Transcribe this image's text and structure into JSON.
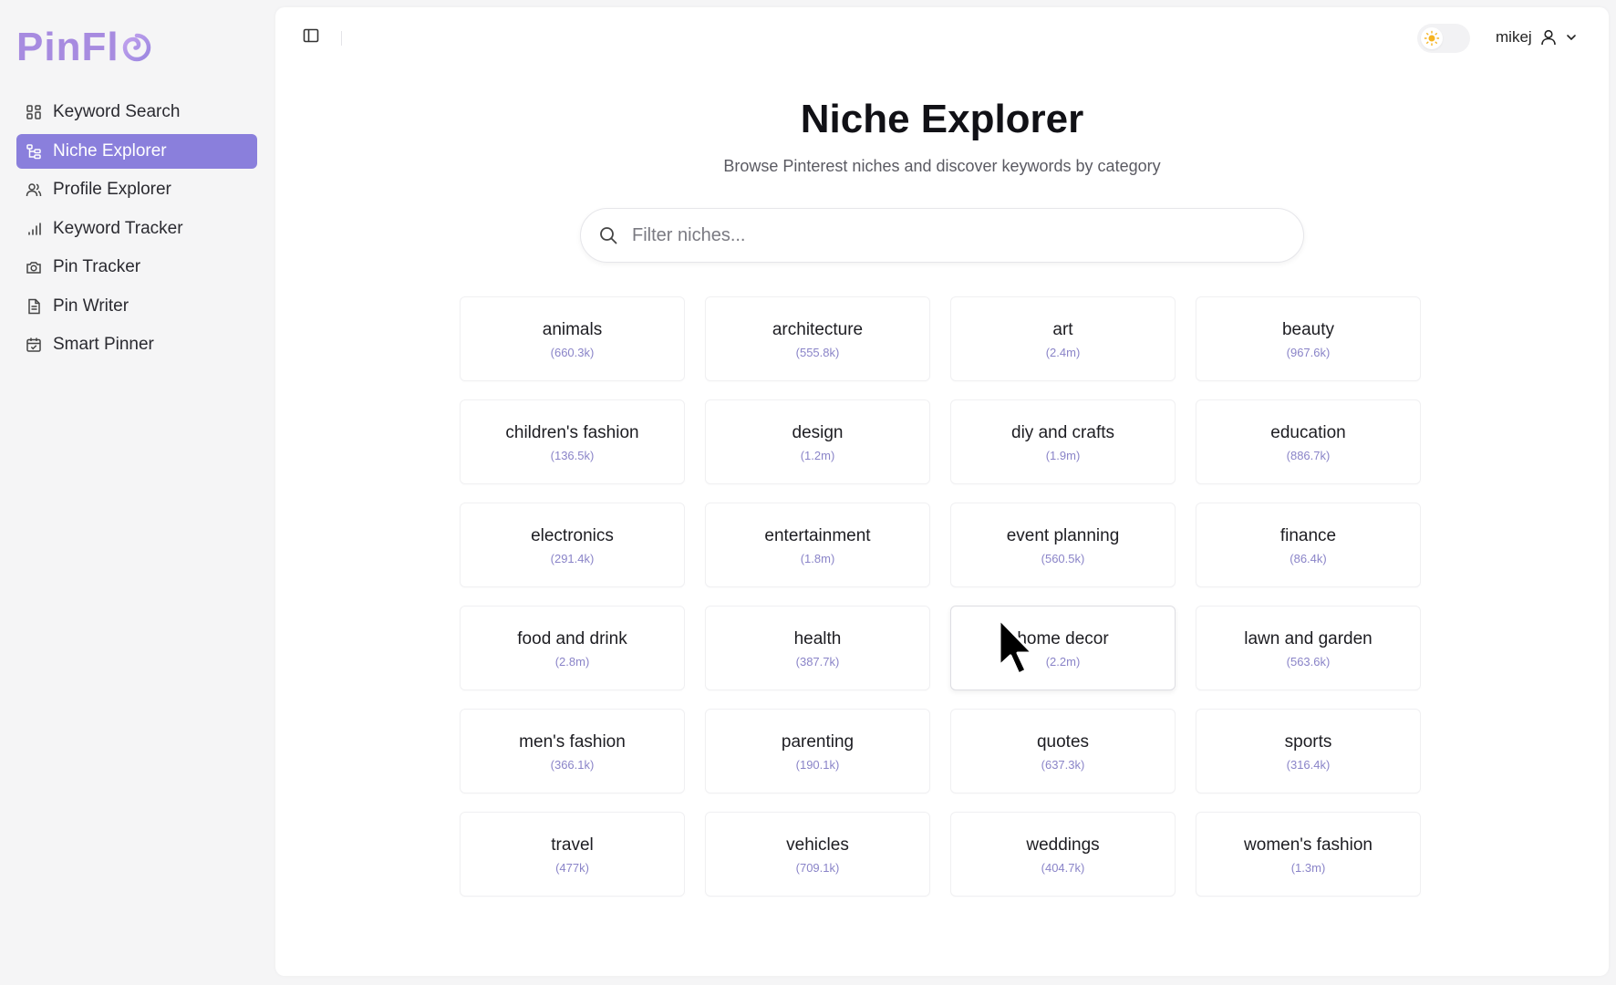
{
  "app": {
    "logo_text": "PinFl",
    "brand_color": "#a78be0",
    "accent_color": "#8a7fdc"
  },
  "sidebar": {
    "items": [
      {
        "label": "Keyword Search",
        "icon": "grid-icon",
        "active": false
      },
      {
        "label": "Niche Explorer",
        "icon": "hierarchy-icon",
        "active": true
      },
      {
        "label": "Profile Explorer",
        "icon": "users-icon",
        "active": false
      },
      {
        "label": "Keyword Tracker",
        "icon": "bar-chart-icon",
        "active": false
      },
      {
        "label": "Pin Tracker",
        "icon": "camera-icon",
        "active": false
      },
      {
        "label": "Pin Writer",
        "icon": "document-icon",
        "active": false
      },
      {
        "label": "Smart Pinner",
        "icon": "calendar-check-icon",
        "active": false
      }
    ]
  },
  "topbar": {
    "username": "mikej",
    "theme": "light"
  },
  "page": {
    "title": "Niche Explorer",
    "subtitle": "Browse Pinterest niches and discover keywords by category"
  },
  "search": {
    "placeholder": "Filter niches...",
    "value": ""
  },
  "niches": [
    {
      "name": "animals",
      "count": "(660.3k)"
    },
    {
      "name": "architecture",
      "count": "(555.8k)"
    },
    {
      "name": "art",
      "count": "(2.4m)"
    },
    {
      "name": "beauty",
      "count": "(967.6k)"
    },
    {
      "name": "children's fashion",
      "count": "(136.5k)"
    },
    {
      "name": "design",
      "count": "(1.2m)"
    },
    {
      "name": "diy and crafts",
      "count": "(1.9m)"
    },
    {
      "name": "education",
      "count": "(886.7k)"
    },
    {
      "name": "electronics",
      "count": "(291.4k)"
    },
    {
      "name": "entertainment",
      "count": "(1.8m)"
    },
    {
      "name": "event planning",
      "count": "(560.5k)"
    },
    {
      "name": "finance",
      "count": "(86.4k)"
    },
    {
      "name": "food and drink",
      "count": "(2.8m)"
    },
    {
      "name": "health",
      "count": "(387.7k)"
    },
    {
      "name": "home decor",
      "count": "(2.2m)",
      "hovered": true
    },
    {
      "name": "lawn and garden",
      "count": "(563.6k)"
    },
    {
      "name": "men's fashion",
      "count": "(366.1k)"
    },
    {
      "name": "parenting",
      "count": "(190.1k)"
    },
    {
      "name": "quotes",
      "count": "(637.3k)"
    },
    {
      "name": "sports",
      "count": "(316.4k)"
    },
    {
      "name": "travel",
      "count": "(477k)"
    },
    {
      "name": "vehicles",
      "count": "(709.1k)"
    },
    {
      "name": "weddings",
      "count": "(404.7k)"
    },
    {
      "name": "women's fashion",
      "count": "(1.3m)"
    }
  ]
}
